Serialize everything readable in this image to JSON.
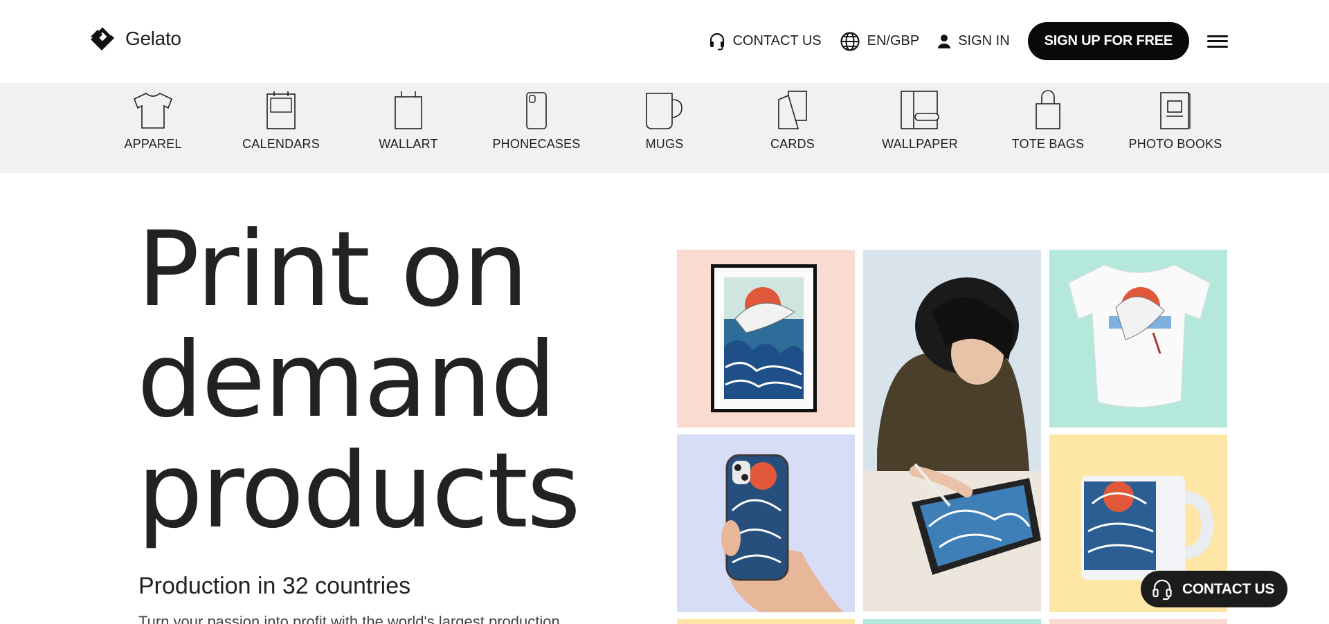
{
  "brand": {
    "name": "Gelato"
  },
  "header": {
    "contact": "CONTACT US",
    "locale": "EN/GBP",
    "signin": "SIGN IN",
    "signup": "SIGN UP FOR FREE"
  },
  "categories": [
    {
      "label": "APPAREL",
      "icon": "tshirt-icon"
    },
    {
      "label": "CALENDARS",
      "icon": "calendar-icon"
    },
    {
      "label": "WALLART",
      "icon": "wallart-icon"
    },
    {
      "label": "PHONECASES",
      "icon": "phonecase-icon"
    },
    {
      "label": "MUGS",
      "icon": "mug-icon"
    },
    {
      "label": "CARDS",
      "icon": "cards-icon"
    },
    {
      "label": "WALLPAPER",
      "icon": "wallpaper-icon"
    },
    {
      "label": "TOTE BAGS",
      "icon": "totebag-icon"
    },
    {
      "label": "PHOTO BOOKS",
      "icon": "photobook-icon"
    }
  ],
  "hero": {
    "title_line1": "Print on",
    "title_line2": "demand",
    "title_line3": "products",
    "subtitle": "Production in 32 countries",
    "paragraph": "Turn your passion into profit with the world's largest production"
  },
  "fab": {
    "label": "CONTACT US"
  },
  "colors": {
    "tile_pink": "#f9dbd1",
    "tile_mint": "#b5e8dc",
    "tile_lavender": "#d7dcf7",
    "tile_yellow": "#fde6a6",
    "tile_blue": "#dce6ef"
  }
}
